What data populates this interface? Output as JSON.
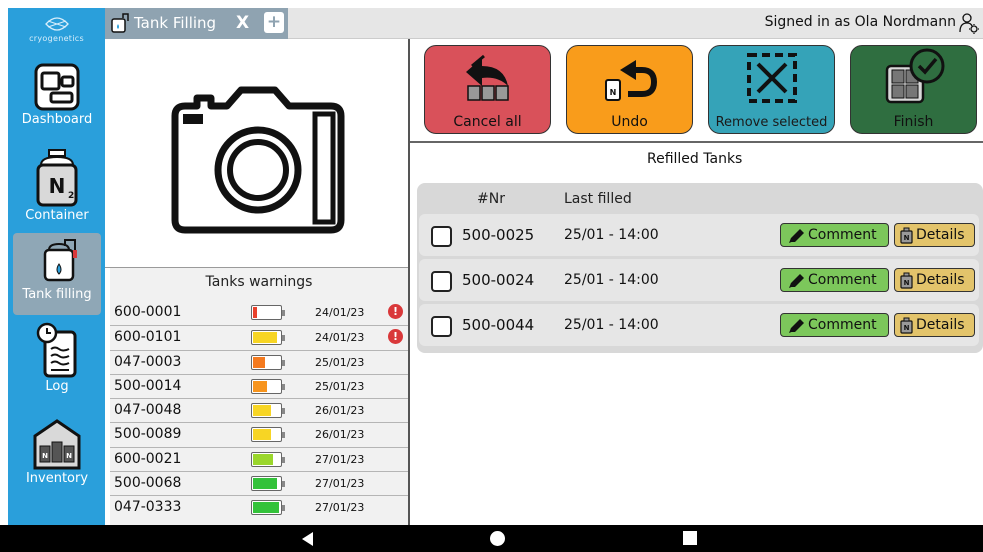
{
  "brand": {
    "name": "cryogenetics"
  },
  "sidebar": {
    "items": [
      {
        "label": "Dashboard",
        "icon": "dashboard-icon"
      },
      {
        "label": "Container",
        "icon": "nitrogen-container-icon"
      },
      {
        "label": "Tank filling",
        "icon": "tank-filling-icon",
        "active": true
      },
      {
        "label": "Log",
        "icon": "clock-log-icon"
      },
      {
        "label": "Inventory",
        "icon": "inventory-icon"
      }
    ]
  },
  "tabbar": {
    "active_tab": "Tank Filling",
    "close_label": "X",
    "add_label": "+",
    "signed_in": "Signed in as Ola Nordmann"
  },
  "actions": {
    "cancel_all": "Cancel all",
    "undo": "Undo",
    "remove_selected": "Remove selected",
    "finish": "Finish"
  },
  "warnings": {
    "title": "Tanks warnings",
    "rows": [
      {
        "id": "600-0001",
        "date": "24/01/23",
        "level": 0.15,
        "color": "#e8412c",
        "alert": true
      },
      {
        "id": "600-0101",
        "date": "24/01/23",
        "level": 0.9,
        "color": "#f7d524",
        "alert": true
      },
      {
        "id": "047-0003",
        "date": "25/01/23",
        "level": 0.45,
        "color": "#f47a1f",
        "alert": false
      },
      {
        "id": "500-0014",
        "date": "25/01/23",
        "level": 0.5,
        "color": "#f7941d",
        "alert": false
      },
      {
        "id": "047-0048",
        "date": "26/01/23",
        "level": 0.65,
        "color": "#f7d524",
        "alert": false
      },
      {
        "id": "500-0089",
        "date": "26/01/23",
        "level": 0.65,
        "color": "#f7d524",
        "alert": false
      },
      {
        "id": "600-0021",
        "date": "27/01/23",
        "level": 0.75,
        "color": "#9ad62b",
        "alert": false
      },
      {
        "id": "500-0068",
        "date": "27/01/23",
        "level": 0.9,
        "color": "#33c23a",
        "alert": false
      },
      {
        "id": "047-0333",
        "date": "27/01/23",
        "level": 0.95,
        "color": "#33c23a",
        "alert": false
      }
    ]
  },
  "refilled": {
    "title": "Refilled Tanks",
    "col_nr": "#Nr",
    "col_last": "Last filled",
    "comment_label": "Comment",
    "details_label": "Details",
    "rows": [
      {
        "id": "500-0025",
        "last": "25/01 - 14:00"
      },
      {
        "id": "500-0024",
        "last": "25/01 - 14:00"
      },
      {
        "id": "500-0044",
        "last": "25/01 - 14:00"
      }
    ]
  }
}
